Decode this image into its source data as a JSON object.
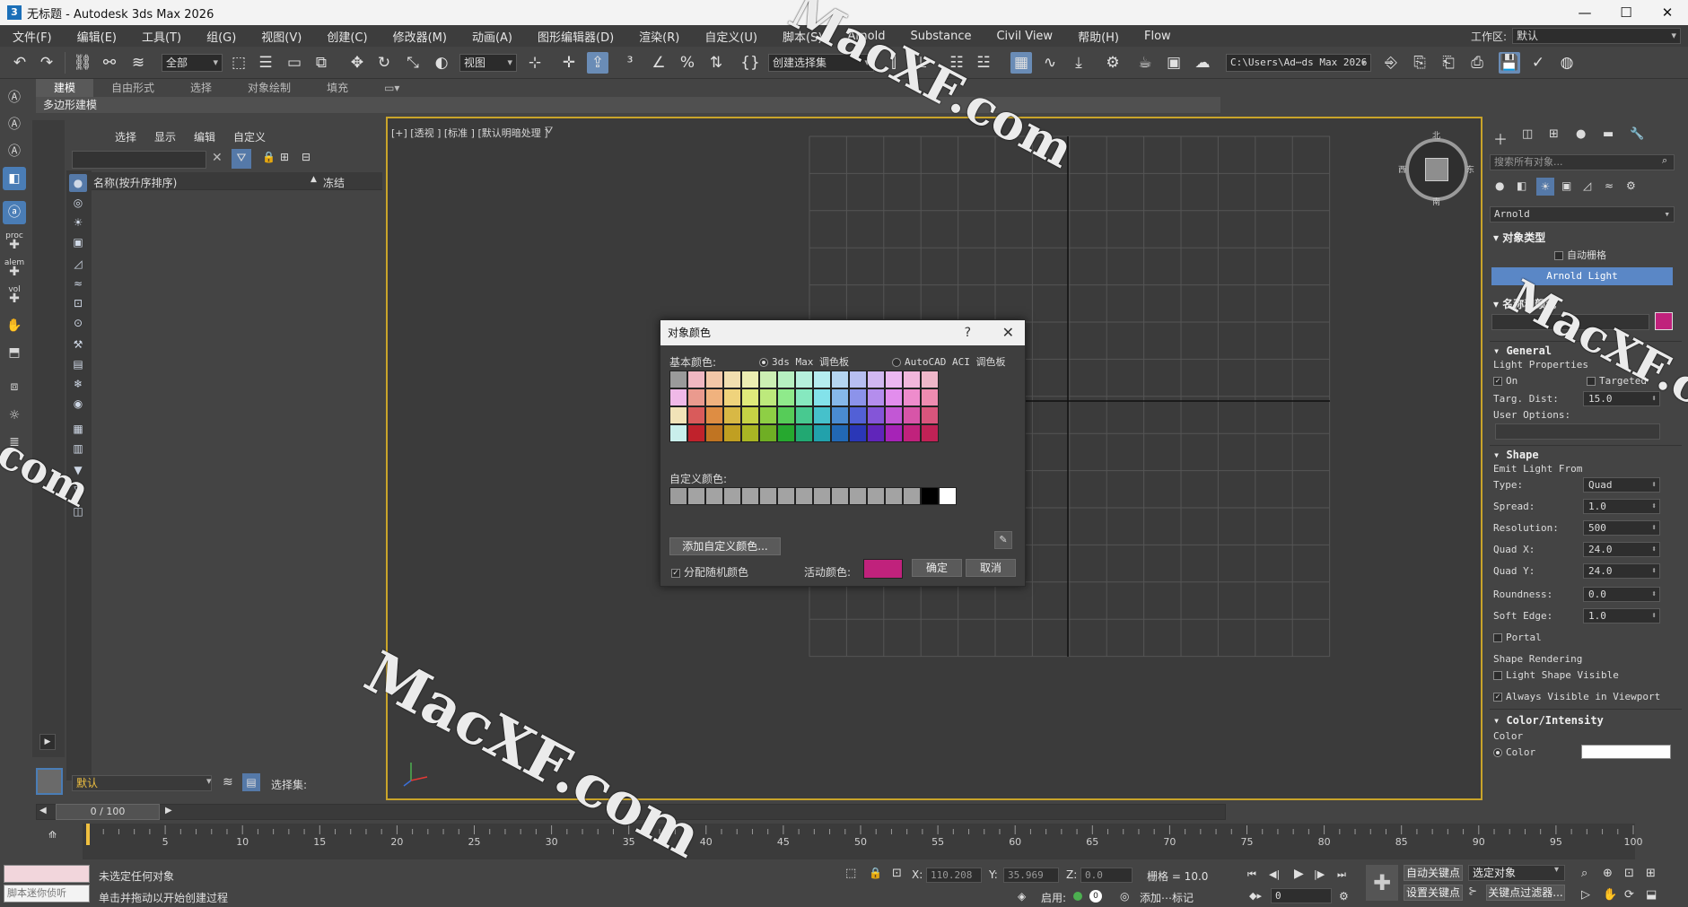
{
  "window": {
    "title": "无标题 - Autodesk 3ds Max 2026",
    "icon_label": "3",
    "controls": [
      "—",
      "☐",
      "✕"
    ]
  },
  "menu": [
    "文件(F)",
    "编辑(E)",
    "工具(T)",
    "组(G)",
    "视图(V)",
    "创建(C)",
    "修改器(M)",
    "动画(A)",
    "图形编辑器(D)",
    "渲染(R)",
    "自定义(U)",
    "脚本(S)",
    "Arnold",
    "Substance",
    "Civil View",
    "帮助(H)",
    "Flow"
  ],
  "workspace": {
    "label": "工作区:",
    "value": "默认"
  },
  "toolbar": {
    "selection_filter": "全部",
    "ref_coord": "视图",
    "named_selection": "创建选择集",
    "project_path": "C:\\Users\\Ad⋯ds Max 2026"
  },
  "ribbon": {
    "tabs": [
      "建模",
      "自由形式",
      "选择",
      "对象绘制",
      "填充"
    ],
    "active_tab": "建模",
    "sub_label": "多边形建模"
  },
  "left_strip": {
    "labels": [
      "proc",
      "alem",
      "vol"
    ]
  },
  "explorer": {
    "tabs": [
      "选择",
      "显示",
      "编辑",
      "自定义"
    ],
    "column_name": "名称(按升序排序)",
    "column_sort": "▲",
    "column_frozen": "冻结",
    "layer_value": "默认",
    "selection_set_label": "选择集:"
  },
  "viewport": {
    "label": "[+] [透视 ] [标准 ] [默认明暗处理 ]",
    "viewcube": {
      "top": "北",
      "left": "西",
      "right": "东",
      "bottom": "南"
    }
  },
  "command_panel": {
    "search_placeholder": "搜索所有对象...",
    "category": "Arnold",
    "object_type_header": "对象类型",
    "auto_grid": "自动栅格",
    "object_button": "Arnold Light",
    "name_color_header": "名称和颜色",
    "object_color": "#c0227c",
    "general_header": "General",
    "light_properties": "Light Properties",
    "on_label": "On",
    "on_checked": true,
    "targeted_label": "Targeted",
    "targeted_checked": false,
    "targ_dist_label": "Targ. Dist:",
    "targ_dist_value": "15.0",
    "user_options_label": "User Options:",
    "shape_header": "Shape",
    "emit_from_label": "Emit Light From",
    "type_label": "Type:",
    "type_value": "Quad",
    "spread_label": "Spread:",
    "spread_value": "1.0",
    "resolution_label": "Resolution:",
    "resolution_value": "500",
    "quadx_label": "Quad X:",
    "quadx_value": "24.0",
    "quady_label": "Quad Y:",
    "quady_value": "24.0",
    "roundness_label": "Roundness:",
    "roundness_value": "0.0",
    "softedge_label": "Soft Edge:",
    "softedge_value": "1.0",
    "portal_label": "Portal",
    "portal_checked": false,
    "shape_rendering_label": "Shape Rendering",
    "light_shape_visible": "Light Shape Visible",
    "light_shape_visible_checked": false,
    "always_visible": "Always Visible in Viewport",
    "always_visible_checked": true,
    "color_intensity_header": "Color/Intensity",
    "color_label": "Color",
    "color_radio_label": "Color"
  },
  "dialog": {
    "title": "对象颜色",
    "help": "?",
    "close": "✕",
    "basic_colors_label": "基本颜色:",
    "palette_max": "3ds Max 调色板",
    "palette_autocad": "AutoCAD ACI 调色板",
    "palette_selected": "3ds Max 调色板",
    "custom_colors_label": "自定义颜色:",
    "add_custom_button": "添加自定义颜色...",
    "random_color_label": "分配随机颜色",
    "random_color_checked": true,
    "active_color_label": "活动颜色:",
    "active_color": "#c0227c",
    "ok_button": "确定",
    "cancel_button": "取消",
    "basic_colors": [
      [
        "#9a9a9a",
        "#efb7c2",
        "#f2c7a8",
        "#f1deb0",
        "#ecedb2",
        "#ccefb3",
        "#b6efc0",
        "#b6efdc",
        "#b5ecef",
        "#b5d5f0",
        "#b7bff1",
        "#d1b8f1",
        "#ebb8f1",
        "#f1b7dc",
        "#efb7c9"
      ],
      [
        "#f0b9e8",
        "#ea9a8e",
        "#f0b27e",
        "#efd37c",
        "#e0ea7b",
        "#bde97c",
        "#8fea8b",
        "#86e8bf",
        "#83e2ea",
        "#86b8ea",
        "#8c93ea",
        "#b48ded",
        "#e28ded",
        "#ee8ccc",
        "#ee8cb0"
      ],
      [
        "#f1e3b8",
        "#d95b5b",
        "#de8d43",
        "#d8b845",
        "#c6d245",
        "#8ecf45",
        "#56cc58",
        "#48c990",
        "#46c1cb",
        "#4a8bd1",
        "#5260d6",
        "#8455d8",
        "#c257d5",
        "#d755a8",
        "#d8557c"
      ],
      [
        "#c9efec",
        "#c0222c",
        "#c07422",
        "#c09f22",
        "#a9b524",
        "#6fae24",
        "#26a82f",
        "#22a872",
        "#22a1ab",
        "#2268b4",
        "#2a37b7",
        "#6025ba",
        "#a623b7",
        "#c0227c",
        "#c02256"
      ]
    ],
    "custom_colors": [
      "#9c9c9c",
      "#a3a3a3",
      "#a3a3a3",
      "#a3a3a3",
      "#a3a3a3",
      "#a3a3a3",
      "#a3a3a3",
      "#a3a3a3",
      "#a3a3a3",
      "#a3a3a3",
      "#a3a3a3",
      "#a3a3a3",
      "#a3a3a3",
      "#a3a3a3",
      "#000000",
      "#ffffff"
    ]
  },
  "timeline": {
    "frame_display": "0 / 100",
    "ticks": [
      "5",
      "10",
      "15",
      "20",
      "25",
      "30",
      "35",
      "40",
      "45",
      "50",
      "55",
      "60",
      "65",
      "70",
      "75",
      "80",
      "85",
      "90",
      "95",
      "100"
    ]
  },
  "statusbar": {
    "script_placeholder": "脚本迷你侦听",
    "status_text": "未选定任何对象",
    "prompt_text": "单击并拖动以开始创建过程",
    "x_label": "X:",
    "x_value": "110.208",
    "y_label": "Y:",
    "y_value": "35.969",
    "z_label": "Z:",
    "z_value": "0.0",
    "grid_text": "栅格 = 10.0",
    "enable_label": "启用:",
    "add_tag": "添加⋯标记",
    "auto_key": "自动关键点",
    "set_key": "设置关键点",
    "key_filter": "关键点过滤器...",
    "selection_dropdown": "选定对象",
    "frame_field": "0"
  },
  "watermarks": [
    "MacXF.com",
    "MacXF.com",
    "MacXF.com",
    ".com"
  ]
}
